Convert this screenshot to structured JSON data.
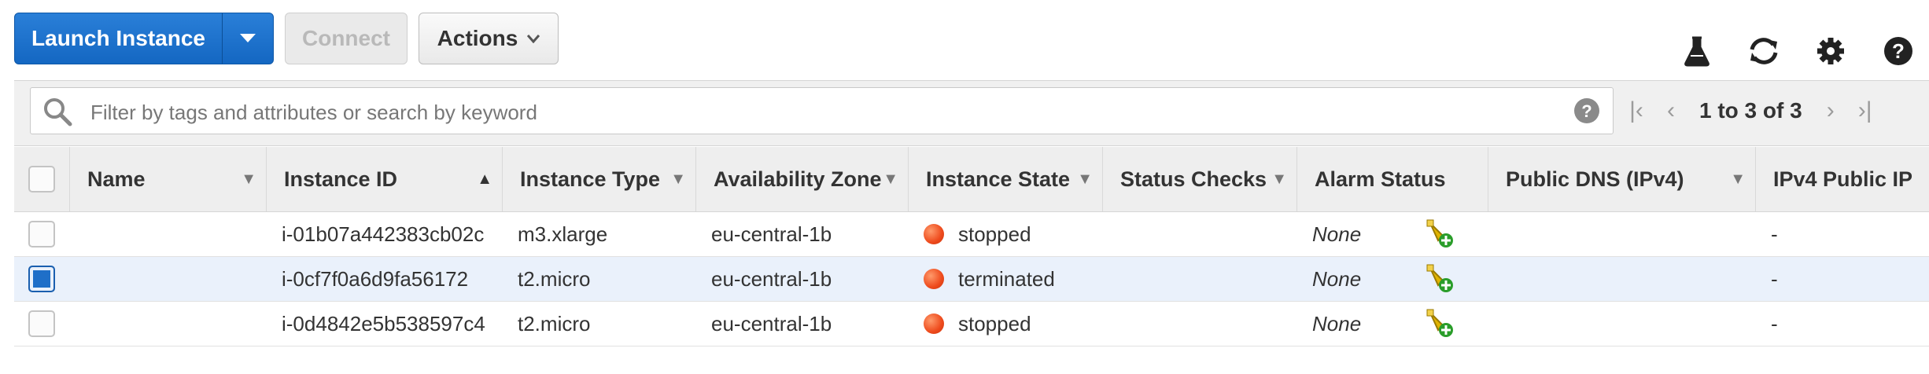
{
  "toolbar": {
    "launch_label": "Launch Instance",
    "connect_label": "Connect",
    "actions_label": "Actions",
    "colors": {
      "primary": "#1467c2",
      "disabled_text": "#b9b9b9"
    }
  },
  "top_icons": [
    "flask-icon",
    "refresh-icon",
    "gear-icon",
    "help-icon"
  ],
  "filter": {
    "placeholder": "Filter by tags and attributes or search by keyword",
    "pagination": "1 to 3 of 3"
  },
  "table": {
    "columns": [
      {
        "label": "Name",
        "sort": "dropdown"
      },
      {
        "label": "Instance ID",
        "sort": "ascending"
      },
      {
        "label": "Instance Type",
        "sort": "dropdown"
      },
      {
        "label": "Availability Zone",
        "sort": "dropdown"
      },
      {
        "label": "Instance State",
        "sort": "dropdown"
      },
      {
        "label": "Status Checks",
        "sort": "dropdown"
      },
      {
        "label": "Alarm Status",
        "sort": "none"
      },
      {
        "label": "Public DNS (IPv4)",
        "sort": "dropdown"
      },
      {
        "label": "IPv4 Public IP",
        "sort": "none"
      }
    ],
    "rows": [
      {
        "selected": false,
        "name": "",
        "instance_id": "i-01b07a442383cb02c",
        "type": "m3.xlarge",
        "zone": "eu-central-1b",
        "state": "stopped",
        "status_checks": "",
        "alarm": "None",
        "public_dns": "",
        "public_ip": "-"
      },
      {
        "selected": true,
        "name": "",
        "instance_id": "i-0cf7f0a6d9fa56172",
        "type": "t2.micro",
        "zone": "eu-central-1b",
        "state": "terminated",
        "status_checks": "",
        "alarm": "None",
        "public_dns": "",
        "public_ip": "-"
      },
      {
        "selected": false,
        "name": "",
        "instance_id": "i-0d4842e5b538597c4",
        "type": "t2.micro",
        "zone": "eu-central-1b",
        "state": "stopped",
        "status_checks": "",
        "alarm": "None",
        "public_dns": "",
        "public_ip": "-"
      }
    ],
    "state_color": "#ee4a1c",
    "selected_row_color": "#eaf1fb"
  }
}
